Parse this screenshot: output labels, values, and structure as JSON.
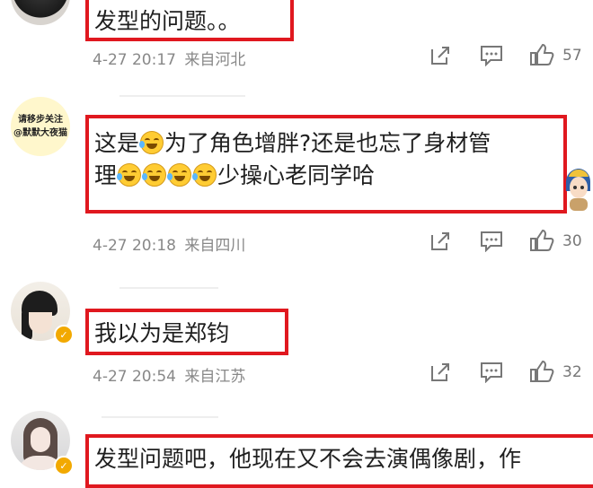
{
  "comments": [
    {
      "text_line1": "发型的问题。。",
      "time": "4-27 20:17",
      "location": "来自河北",
      "likes": "57"
    },
    {
      "avatar_text_1": "请移步关注",
      "avatar_text_2": "@默默大夜猫",
      "text_line1_a": "这是",
      "text_line1_b": "为了角色增胖?还是也忘了身材管",
      "text_line2_a": "理",
      "text_line2_b": "少操心老同学哈",
      "time": "4-27 20:18",
      "location": "来自四川",
      "likes": "30"
    },
    {
      "text_line1": "我以为是郑钧",
      "time": "4-27 20:54",
      "location": "来自江苏",
      "likes": "32"
    },
    {
      "text_line1": "发型问题吧，他现在又不会去演偶像剧，作"
    }
  ],
  "icons": {
    "share": "share-icon",
    "comment": "comment-icon",
    "like": "thumbs-up-icon",
    "verified": "verified-badge-icon",
    "emoji": "laugh-cry-emoji-icon"
  },
  "colors": {
    "highlight": "#e0181f",
    "meta": "#888888",
    "verified": "#f2a900"
  }
}
